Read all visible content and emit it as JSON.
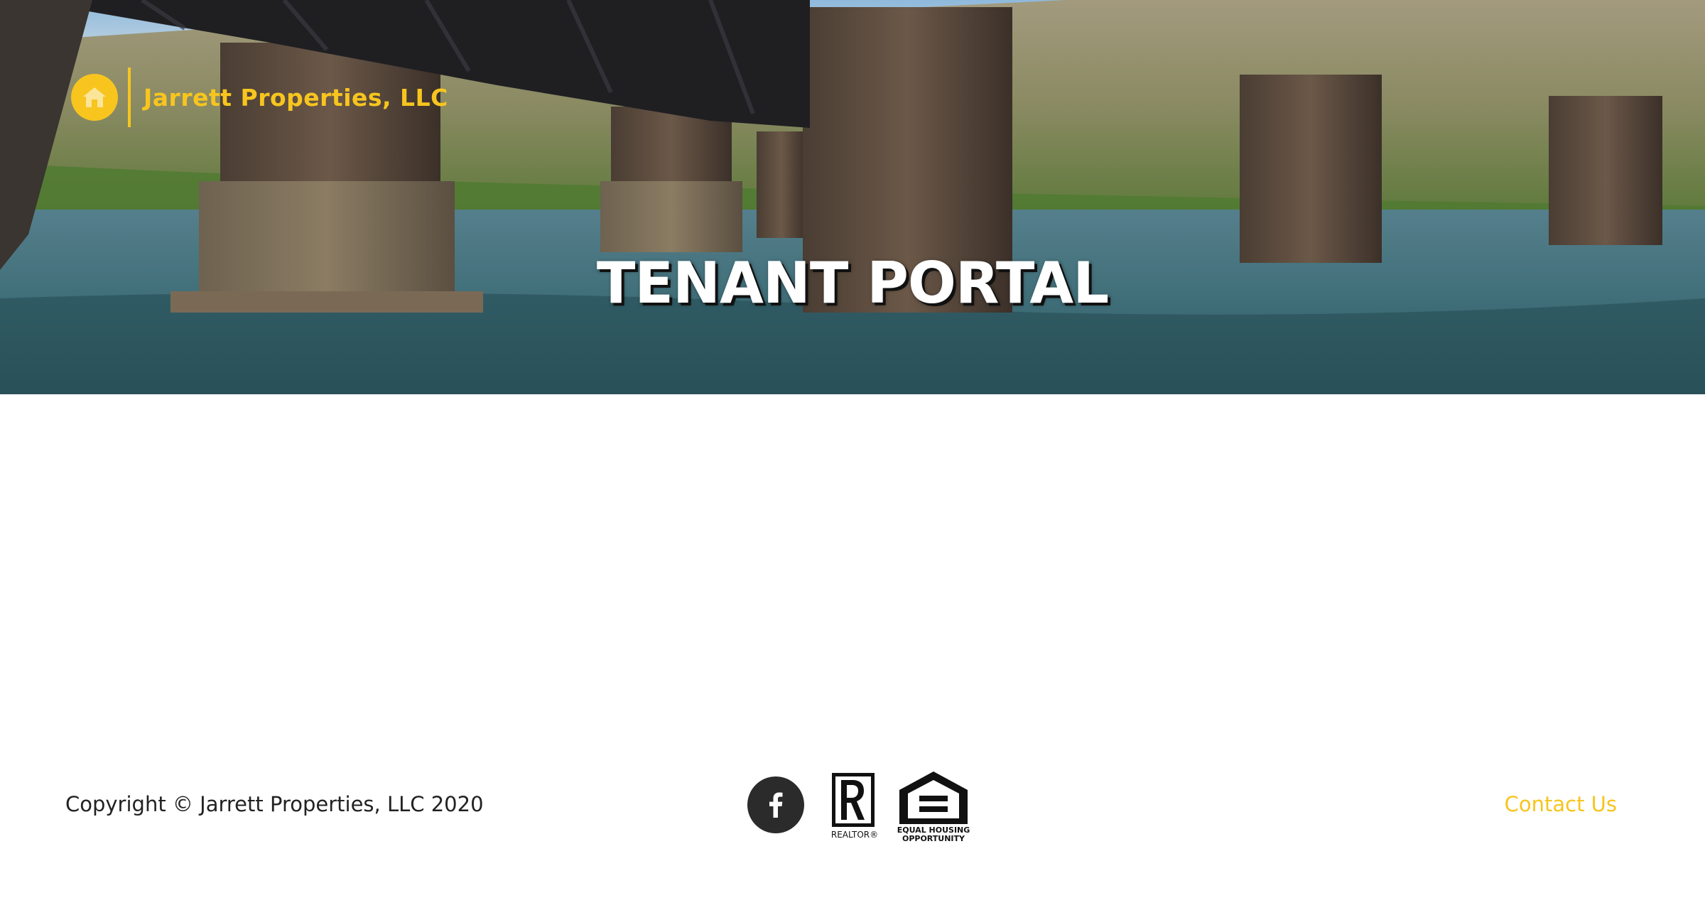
{
  "header": {
    "brand_name": "Jarrett Properties, LLC",
    "brand_color": "#f7c51e"
  },
  "hero": {
    "title": "TENANT PORTAL",
    "image_alt": "Railroad bridge with stone piers over a river"
  },
  "footer": {
    "copyright": "Copyright © Jarrett Properties, LLC 2020",
    "social": {
      "icon": "facebook-icon"
    },
    "badges": {
      "realtor_label": "REALTOR®",
      "eho_line1": "EQUAL HOUSING",
      "eho_line2": "OPPORTUNITY"
    },
    "contact_label": "Contact Us"
  }
}
